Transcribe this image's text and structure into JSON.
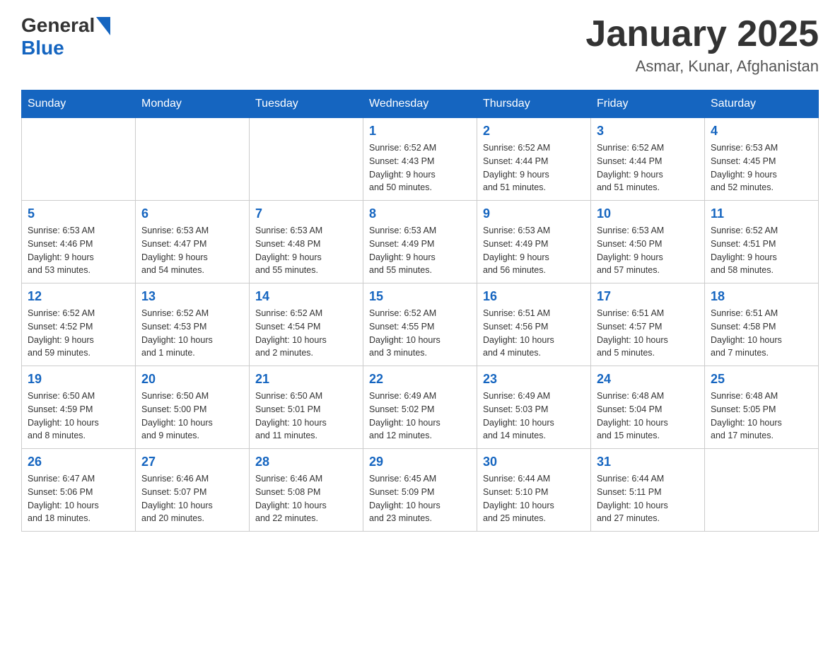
{
  "header": {
    "logo_general": "General",
    "logo_blue": "Blue",
    "month_title": "January 2025",
    "location": "Asmar, Kunar, Afghanistan"
  },
  "weekdays": [
    "Sunday",
    "Monday",
    "Tuesday",
    "Wednesday",
    "Thursday",
    "Friday",
    "Saturday"
  ],
  "weeks": [
    [
      {
        "day": "",
        "info": ""
      },
      {
        "day": "",
        "info": ""
      },
      {
        "day": "",
        "info": ""
      },
      {
        "day": "1",
        "info": "Sunrise: 6:52 AM\nSunset: 4:43 PM\nDaylight: 9 hours\nand 50 minutes."
      },
      {
        "day": "2",
        "info": "Sunrise: 6:52 AM\nSunset: 4:44 PM\nDaylight: 9 hours\nand 51 minutes."
      },
      {
        "day": "3",
        "info": "Sunrise: 6:52 AM\nSunset: 4:44 PM\nDaylight: 9 hours\nand 51 minutes."
      },
      {
        "day": "4",
        "info": "Sunrise: 6:53 AM\nSunset: 4:45 PM\nDaylight: 9 hours\nand 52 minutes."
      }
    ],
    [
      {
        "day": "5",
        "info": "Sunrise: 6:53 AM\nSunset: 4:46 PM\nDaylight: 9 hours\nand 53 minutes."
      },
      {
        "day": "6",
        "info": "Sunrise: 6:53 AM\nSunset: 4:47 PM\nDaylight: 9 hours\nand 54 minutes."
      },
      {
        "day": "7",
        "info": "Sunrise: 6:53 AM\nSunset: 4:48 PM\nDaylight: 9 hours\nand 55 minutes."
      },
      {
        "day": "8",
        "info": "Sunrise: 6:53 AM\nSunset: 4:49 PM\nDaylight: 9 hours\nand 55 minutes."
      },
      {
        "day": "9",
        "info": "Sunrise: 6:53 AM\nSunset: 4:49 PM\nDaylight: 9 hours\nand 56 minutes."
      },
      {
        "day": "10",
        "info": "Sunrise: 6:53 AM\nSunset: 4:50 PM\nDaylight: 9 hours\nand 57 minutes."
      },
      {
        "day": "11",
        "info": "Sunrise: 6:52 AM\nSunset: 4:51 PM\nDaylight: 9 hours\nand 58 minutes."
      }
    ],
    [
      {
        "day": "12",
        "info": "Sunrise: 6:52 AM\nSunset: 4:52 PM\nDaylight: 9 hours\nand 59 minutes."
      },
      {
        "day": "13",
        "info": "Sunrise: 6:52 AM\nSunset: 4:53 PM\nDaylight: 10 hours\nand 1 minute."
      },
      {
        "day": "14",
        "info": "Sunrise: 6:52 AM\nSunset: 4:54 PM\nDaylight: 10 hours\nand 2 minutes."
      },
      {
        "day": "15",
        "info": "Sunrise: 6:52 AM\nSunset: 4:55 PM\nDaylight: 10 hours\nand 3 minutes."
      },
      {
        "day": "16",
        "info": "Sunrise: 6:51 AM\nSunset: 4:56 PM\nDaylight: 10 hours\nand 4 minutes."
      },
      {
        "day": "17",
        "info": "Sunrise: 6:51 AM\nSunset: 4:57 PM\nDaylight: 10 hours\nand 5 minutes."
      },
      {
        "day": "18",
        "info": "Sunrise: 6:51 AM\nSunset: 4:58 PM\nDaylight: 10 hours\nand 7 minutes."
      }
    ],
    [
      {
        "day": "19",
        "info": "Sunrise: 6:50 AM\nSunset: 4:59 PM\nDaylight: 10 hours\nand 8 minutes."
      },
      {
        "day": "20",
        "info": "Sunrise: 6:50 AM\nSunset: 5:00 PM\nDaylight: 10 hours\nand 9 minutes."
      },
      {
        "day": "21",
        "info": "Sunrise: 6:50 AM\nSunset: 5:01 PM\nDaylight: 10 hours\nand 11 minutes."
      },
      {
        "day": "22",
        "info": "Sunrise: 6:49 AM\nSunset: 5:02 PM\nDaylight: 10 hours\nand 12 minutes."
      },
      {
        "day": "23",
        "info": "Sunrise: 6:49 AM\nSunset: 5:03 PM\nDaylight: 10 hours\nand 14 minutes."
      },
      {
        "day": "24",
        "info": "Sunrise: 6:48 AM\nSunset: 5:04 PM\nDaylight: 10 hours\nand 15 minutes."
      },
      {
        "day": "25",
        "info": "Sunrise: 6:48 AM\nSunset: 5:05 PM\nDaylight: 10 hours\nand 17 minutes."
      }
    ],
    [
      {
        "day": "26",
        "info": "Sunrise: 6:47 AM\nSunset: 5:06 PM\nDaylight: 10 hours\nand 18 minutes."
      },
      {
        "day": "27",
        "info": "Sunrise: 6:46 AM\nSunset: 5:07 PM\nDaylight: 10 hours\nand 20 minutes."
      },
      {
        "day": "28",
        "info": "Sunrise: 6:46 AM\nSunset: 5:08 PM\nDaylight: 10 hours\nand 22 minutes."
      },
      {
        "day": "29",
        "info": "Sunrise: 6:45 AM\nSunset: 5:09 PM\nDaylight: 10 hours\nand 23 minutes."
      },
      {
        "day": "30",
        "info": "Sunrise: 6:44 AM\nSunset: 5:10 PM\nDaylight: 10 hours\nand 25 minutes."
      },
      {
        "day": "31",
        "info": "Sunrise: 6:44 AM\nSunset: 5:11 PM\nDaylight: 10 hours\nand 27 minutes."
      },
      {
        "day": "",
        "info": ""
      }
    ]
  ]
}
